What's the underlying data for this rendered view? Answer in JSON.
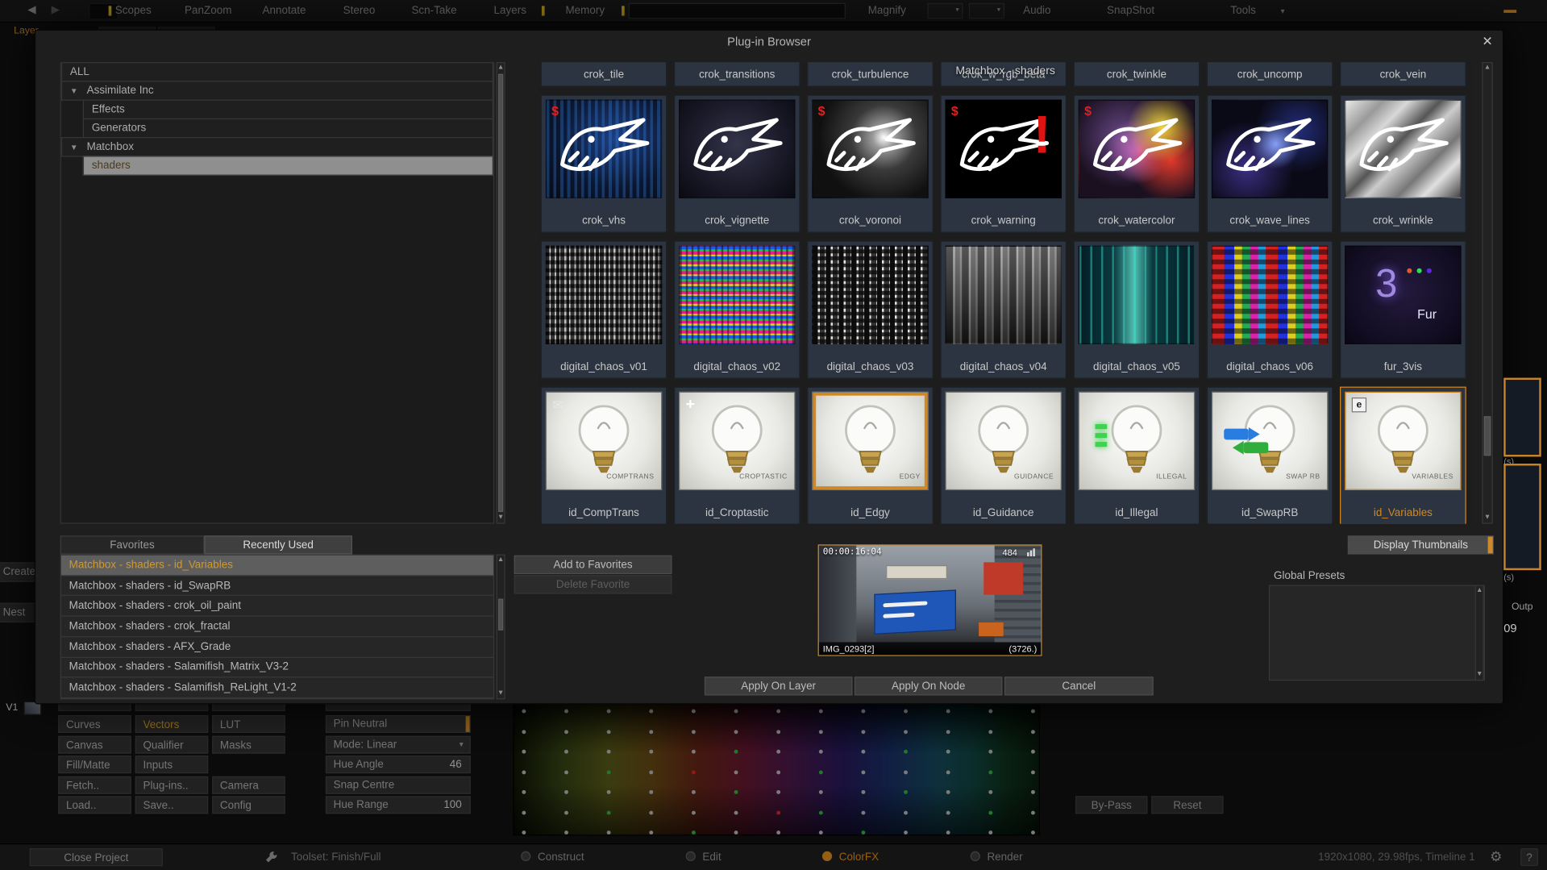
{
  "colors": {
    "accent": "#cd8a2a",
    "highlight_yellow": "#d4b01e"
  },
  "menu": {
    "items": [
      "Scopes",
      "PanZoom",
      "Annotate",
      "Stereo",
      "Scn-Take",
      "Layers",
      "Memory",
      "Magnify",
      "Audio",
      "SnapShot",
      "Tools"
    ],
    "search_value": ""
  },
  "dialog": {
    "title": "Plug-in Browser",
    "close": "✕",
    "tree": {
      "items": [
        {
          "label": "ALL",
          "level": 0,
          "expandable": false
        },
        {
          "label": "Assimilate Inc",
          "level": 0,
          "expandable": true
        },
        {
          "label": "Effects",
          "level": 1
        },
        {
          "label": "Generators",
          "level": 1
        },
        {
          "label": "Matchbox",
          "level": 0,
          "expandable": true
        },
        {
          "label": "shaders",
          "level": 1,
          "selected": true
        }
      ]
    },
    "grid": {
      "header": "Matchbox - shaders",
      "top_labels": [
        "crok_tile",
        "crok_transitions",
        "crok_turbulence",
        "crok_w_rgb_beta",
        "crok_twinkle",
        "crok_uncomp",
        "crok_vein"
      ],
      "items": [
        {
          "name": "crok_vhs",
          "thumb": "croc-vhs",
          "dollar": true
        },
        {
          "name": "crok_vignette",
          "thumb": "croc-vignette"
        },
        {
          "name": "crok_voronoi",
          "thumb": "croc-voronoi",
          "dollar": true
        },
        {
          "name": "crok_warning",
          "thumb": "croc-warning",
          "dollar": true
        },
        {
          "name": "crok_watercolor",
          "thumb": "croc-watercolor",
          "dollar": true
        },
        {
          "name": "crok_wave_lines",
          "thumb": "croc-wave"
        },
        {
          "name": "crok_wrinkle",
          "thumb": "croc-wrinkle"
        },
        {
          "name": "digital_chaos_v01",
          "thumb": "glitch-v01"
        },
        {
          "name": "digital_chaos_v02",
          "thumb": "glitch-v02"
        },
        {
          "name": "digital_chaos_v03",
          "thumb": "glitch-v03"
        },
        {
          "name": "digital_chaos_v04",
          "thumb": "glitch-v04"
        },
        {
          "name": "digital_chaos_v05",
          "thumb": "glitch-v05"
        },
        {
          "name": "digital_chaos_v06",
          "thumb": "glitch-v06"
        },
        {
          "name": "fur_3vis",
          "thumb": "fur"
        },
        {
          "name": "id_CompTrans",
          "thumb": "bulb",
          "caption": "COMPTRANS",
          "badge": "envelope"
        },
        {
          "name": "id_Croptastic",
          "thumb": "bulb",
          "caption": "CROPTASTIC",
          "badge": "crop"
        },
        {
          "name": "id_Edgy",
          "thumb": "bulb",
          "caption": "EDGY",
          "frame": true
        },
        {
          "name": "id_Guidance",
          "thumb": "bulb",
          "caption": "GUIDANCE"
        },
        {
          "name": "id_Illegal",
          "thumb": "bulb",
          "caption": "ILLEGAL",
          "badge": "greenbars"
        },
        {
          "name": "id_SwapRB",
          "thumb": "bulb",
          "caption": "SWAP RB",
          "badge": "swap"
        },
        {
          "name": "id_Variables",
          "thumb": "bulb",
          "caption": "VARIABLES",
          "badge": "ebox",
          "selected": true
        }
      ]
    },
    "panels": {
      "tabs": [
        {
          "label": "Favorites"
        },
        {
          "label": "Recently Used",
          "active": true
        }
      ],
      "recent": [
        {
          "label": "Matchbox - shaders - id_Variables",
          "selected": true
        },
        {
          "label": "Matchbox - shaders - id_SwapRB"
        },
        {
          "label": "Matchbox - shaders - crok_oil_paint"
        },
        {
          "label": "Matchbox - shaders - crok_fractal"
        },
        {
          "label": "Matchbox - shaders - AFX_Grade"
        },
        {
          "label": "Matchbox - shaders - Salamifish_Matrix_V3-2"
        },
        {
          "label": "Matchbox - shaders - Salamifish_ReLight_V1-2"
        }
      ]
    },
    "buttons": {
      "add_favorites": "Add to Favorites",
      "delete_favorite": "Delete Favorite",
      "display_thumbnails": "Display Thumbnails",
      "apply_layer": "Apply On Layer",
      "apply_node": "Apply On Node",
      "cancel": "Cancel"
    },
    "global_presets_label": "Global Presets",
    "preview": {
      "timecode": "00:00:16:04",
      "counter": "484",
      "name": "IMG_0293[2]",
      "frames": "(3726.)"
    }
  },
  "app": {
    "tools": [
      [
        "Curves",
        "Vectors",
        "LUT"
      ],
      [
        "Canvas",
        "Qualifier",
        "Masks"
      ],
      [
        "Fill/Matte",
        "Inputs",
        ""
      ],
      [
        "Fetch..",
        "Plug-ins..",
        "Camera"
      ],
      [
        "Load..",
        "Save..",
        "Config"
      ]
    ],
    "active_tool": "Vectors",
    "controls": [
      {
        "label": "Pin Neutral",
        "accent": true
      },
      {
        "label": "Mode: Linear",
        "dropdown": true
      },
      {
        "label": "Hue Angle",
        "value": "46"
      },
      {
        "label": "Snap Centre"
      },
      {
        "label": "Hue Range",
        "value": "100"
      }
    ],
    "bypass": "By-Pass",
    "reset": "Reset",
    "left": {
      "create": "Create",
      "nest": "Nest",
      "v1": "V1",
      "layer_tab": "Layer"
    },
    "right": {
      "outp": "Outp",
      "num": "09",
      "s1": "(s)",
      "s2": "(s)"
    }
  },
  "bottom": {
    "close_project": "Close Project",
    "toolset": "Toolset: Finish/Full",
    "modes": [
      {
        "label": "Construct"
      },
      {
        "label": "Edit"
      },
      {
        "label": "ColorFX",
        "active": true
      },
      {
        "label": "Render"
      }
    ],
    "status": "1920x1080, 29.98fps, Timeline 1",
    "help": "?"
  }
}
